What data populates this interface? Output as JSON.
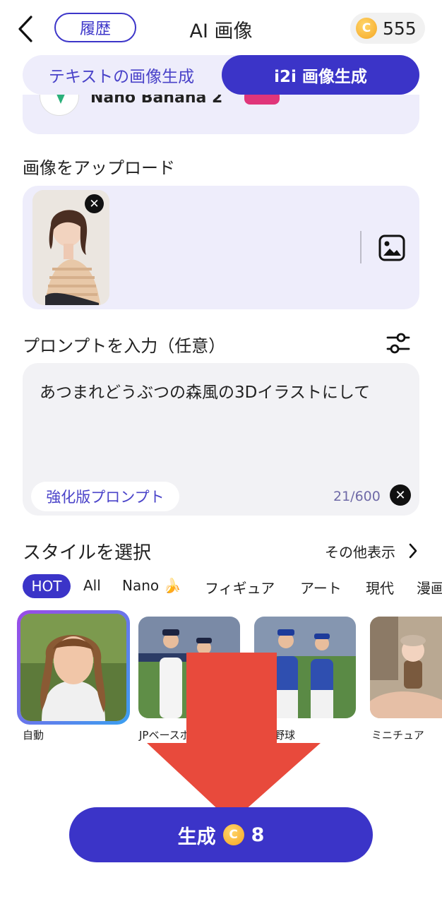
{
  "header": {
    "title": "AI 画像",
    "history_label": "履歴",
    "coin_balance": "555"
  },
  "tabs": [
    {
      "label": "テキストの画像生成",
      "active": false
    },
    {
      "label": "i2i 画像生成",
      "active": true
    }
  ],
  "model": {
    "name": "Nano Banana 2"
  },
  "upload": {
    "section_label": "画像をアップロード"
  },
  "prompt": {
    "section_label": "プロンプトを入力（任意）",
    "text": "あつまれどうぶつの森風の3Dイラストにして",
    "enhance_label": "強化版プロンプト",
    "counter": "21/600"
  },
  "styles": {
    "section_label": "スタイルを選択",
    "more_label": "その他表示",
    "chips": [
      "HOT",
      "All",
      "Nano 🍌",
      "フィギュア",
      "アート",
      "現代",
      "漫画"
    ],
    "active_chip": "HOT",
    "cards": [
      {
        "label": "自動",
        "selected": true
      },
      {
        "label": "JPベースボ",
        "selected": false
      },
      {
        "label": "野球",
        "selected": false
      },
      {
        "label": "ミニチュア",
        "selected": false
      }
    ]
  },
  "generate": {
    "label": "生成",
    "cost": "8"
  },
  "colors": {
    "accent": "#3b34c8",
    "panel": "#eeedfb",
    "arrow": "#e84a3c"
  }
}
